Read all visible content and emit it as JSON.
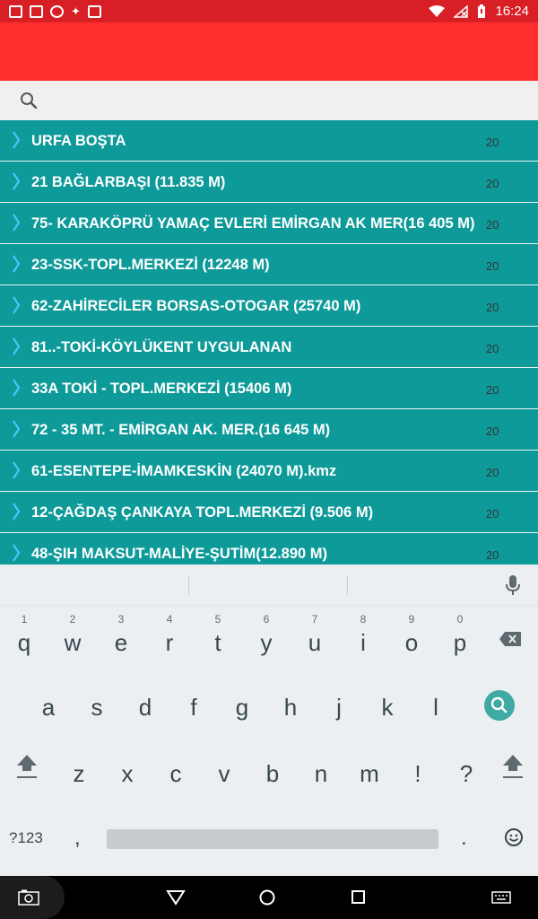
{
  "status_bar": {
    "time": "16:24",
    "icons": [
      "gallery-icon",
      "image-icon",
      "shield-icon",
      "android-icon",
      "briefcase-icon",
      "wifi-icon",
      "no-signal-icon",
      "battery-icon"
    ]
  },
  "search": {
    "placeholder": "",
    "value": ""
  },
  "list": {
    "items": [
      {
        "title": "URFA BOŞTA",
        "count": "20"
      },
      {
        "title": "21 BAĞLARBAŞI  (11.835 M)",
        "count": "20"
      },
      {
        "title": "75- KARAKÖPRÜ YAMAÇ EVLERİ  EMİRGAN AK MER(16 405 M)",
        "count": "20"
      },
      {
        "title": "23-SSK-TOPL.MERKEZİ (12248 M)",
        "count": "20"
      },
      {
        "title": "62-ZAHİRECİLER BORSAS-OTOGAR (25740 M)",
        "count": "20"
      },
      {
        "title": "81..-TOKİ-KÖYLÜKENT UYGULANAN",
        "count": "20"
      },
      {
        "title": "33A TOKİ - TOPL.MERKEZİ (15406 M)",
        "count": "20"
      },
      {
        "title": "72 - 35 MT. - EMİRGAN AK. MER.(16 645 M)",
        "count": "20"
      },
      {
        "title": "61-ESENTEPE-İMAMKESKİN (24070 M).kmz",
        "count": "20"
      },
      {
        "title": "12-ÇAĞDAŞ ÇANKAYA TOPL.MERKEZİ (9.506 M)",
        "count": "20"
      },
      {
        "title": "48-ŞIH MAKSUT-MALİYE-ŞUTİM(12.890 M)",
        "count": "20"
      }
    ]
  },
  "keyboard": {
    "row1": [
      {
        "ch": "q",
        "hint": "1"
      },
      {
        "ch": "w",
        "hint": "2"
      },
      {
        "ch": "e",
        "hint": "3"
      },
      {
        "ch": "r",
        "hint": "4"
      },
      {
        "ch": "t",
        "hint": "5"
      },
      {
        "ch": "y",
        "hint": "6"
      },
      {
        "ch": "u",
        "hint": "7"
      },
      {
        "ch": "i",
        "hint": "8"
      },
      {
        "ch": "o",
        "hint": "9"
      },
      {
        "ch": "p",
        "hint": "0"
      }
    ],
    "row2": [
      "a",
      "s",
      "d",
      "f",
      "g",
      "h",
      "j",
      "k",
      "l"
    ],
    "row3": [
      "z",
      "x",
      "c",
      "v",
      "b",
      "n",
      "m",
      "!",
      "?"
    ],
    "symbols_label": "?123",
    "comma": ",",
    "period": ".",
    "emoji_icon": "emoji-icon"
  },
  "colors": {
    "status_bar": "#d81f26",
    "app_bar": "#ff2e2e",
    "list_bg": "#0f9a9a",
    "chevron": "#4fc3f7",
    "search_key": "#3fa9a4"
  }
}
